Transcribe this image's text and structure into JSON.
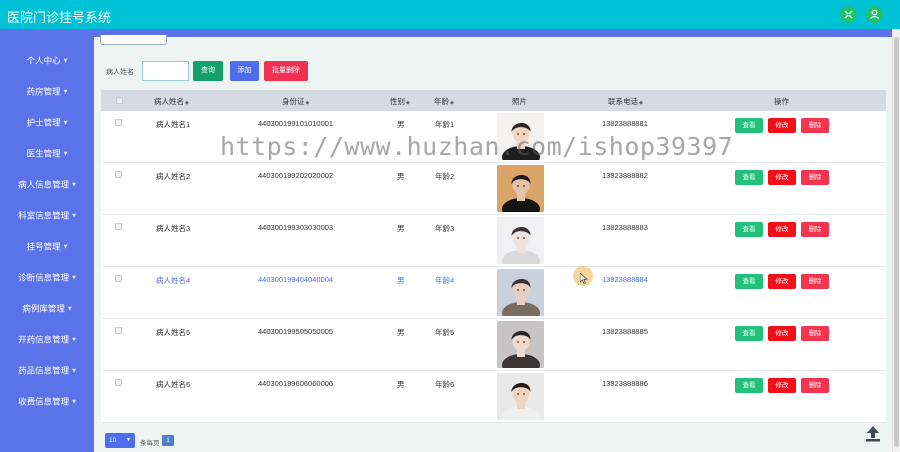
{
  "app": {
    "title": "医院门诊挂号系统"
  },
  "header_icons": [
    "shrink-icon",
    "user-icon"
  ],
  "sidebar": {
    "items": [
      {
        "label": "个人中心",
        "has_caret": true
      },
      {
        "label": "药房管理",
        "has_caret": true
      },
      {
        "label": "护士管理",
        "has_caret": true
      },
      {
        "label": "医生管理",
        "has_caret": true
      },
      {
        "label": "病人信息管理",
        "has_caret": true
      },
      {
        "label": "科室信息管理",
        "has_caret": true
      },
      {
        "label": "挂号管理",
        "has_caret": true
      },
      {
        "label": "诊断信息管理",
        "has_caret": true
      },
      {
        "label": "病例库管理",
        "has_caret": true
      },
      {
        "label": "开药信息管理",
        "has_caret": true
      },
      {
        "label": "药品信息管理",
        "has_caret": true
      },
      {
        "label": "收费信息管理",
        "has_caret": true
      }
    ]
  },
  "search": {
    "label": "病人姓名",
    "value": "",
    "query_button": "查询",
    "add_button": "添加",
    "batch_delete_button": "批量删除"
  },
  "table": {
    "columns": [
      "病人姓名",
      "身份证",
      "性别",
      "年龄",
      "照片",
      "联系电话",
      "操作"
    ],
    "rows": [
      {
        "name": "病人姓名1",
        "id_card": "440300199101010001",
        "gender": "男",
        "age": "年龄1",
        "phone": "13823888881",
        "hovered": false
      },
      {
        "name": "病人姓名2",
        "id_card": "440300199202020002",
        "gender": "男",
        "age": "年龄2",
        "phone": "13823888882",
        "hovered": false
      },
      {
        "name": "病人姓名3",
        "id_card": "440300199303030003",
        "gender": "男",
        "age": "年龄3",
        "phone": "13823888883",
        "hovered": false
      },
      {
        "name": "病人姓名4",
        "id_card": "440300199404040004",
        "gender": "男",
        "age": "年龄4",
        "phone": "13823888884",
        "hovered": true
      },
      {
        "name": "病人姓名5",
        "id_card": "440300199505050005",
        "gender": "男",
        "age": "年龄5",
        "phone": "13823888885",
        "hovered": false
      },
      {
        "name": "病人姓名6",
        "id_card": "440300199606060006",
        "gender": "男",
        "age": "年龄6",
        "phone": "13823888886",
        "hovered": false
      }
    ],
    "actions": {
      "view": "查看",
      "edit": "修改",
      "delete": "删除"
    }
  },
  "pagination": {
    "page_size": "10",
    "per_page_label": "条每页",
    "current_page": "1"
  },
  "watermark": "https://www.huzhan.com/ishop39397",
  "colors": {
    "topbar": "#00c2d6",
    "sidebar": "#5b73e8",
    "view": "#21c07d",
    "edit": "#f30f18",
    "delete": "#f4354f"
  }
}
